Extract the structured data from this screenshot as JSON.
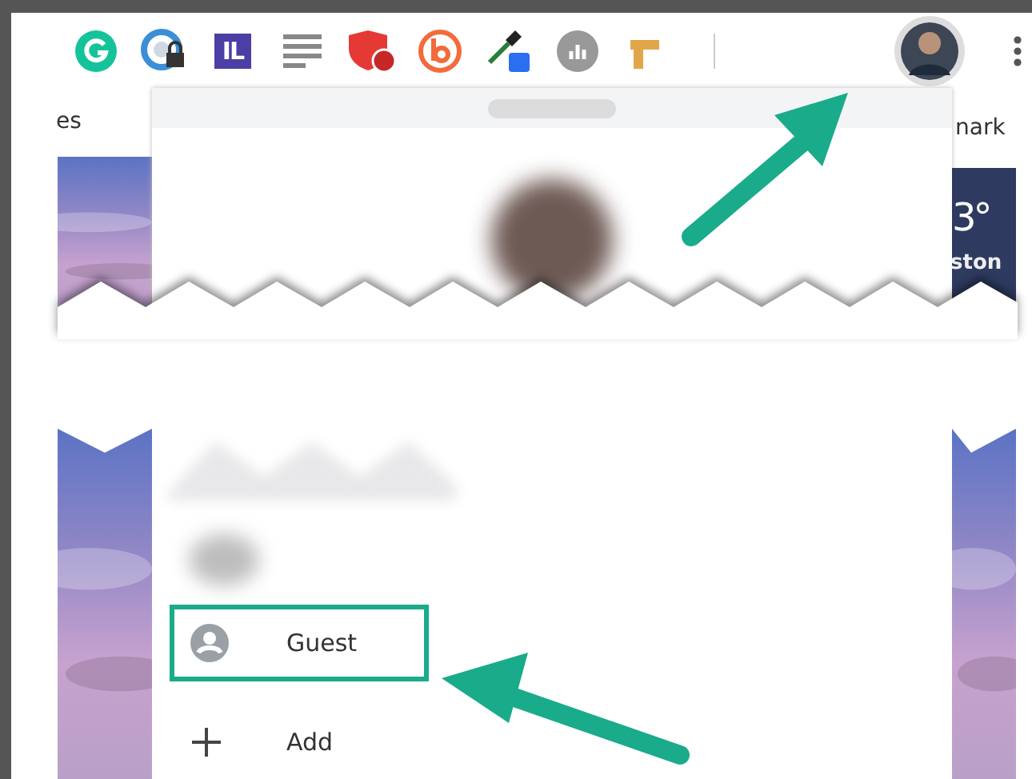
{
  "toolbar": {
    "logo_text": "IL"
  },
  "bookmarks_bar": {
    "left_fragment": "es",
    "right_fragment": "nark"
  },
  "weather_widget": {
    "temperature": "3°",
    "location": "ston"
  },
  "profile_menu": {
    "items": [
      {
        "kind": "guest",
        "label": "Guest",
        "highlighted": true
      },
      {
        "kind": "add",
        "label": "Add",
        "highlighted": false
      }
    ]
  }
}
